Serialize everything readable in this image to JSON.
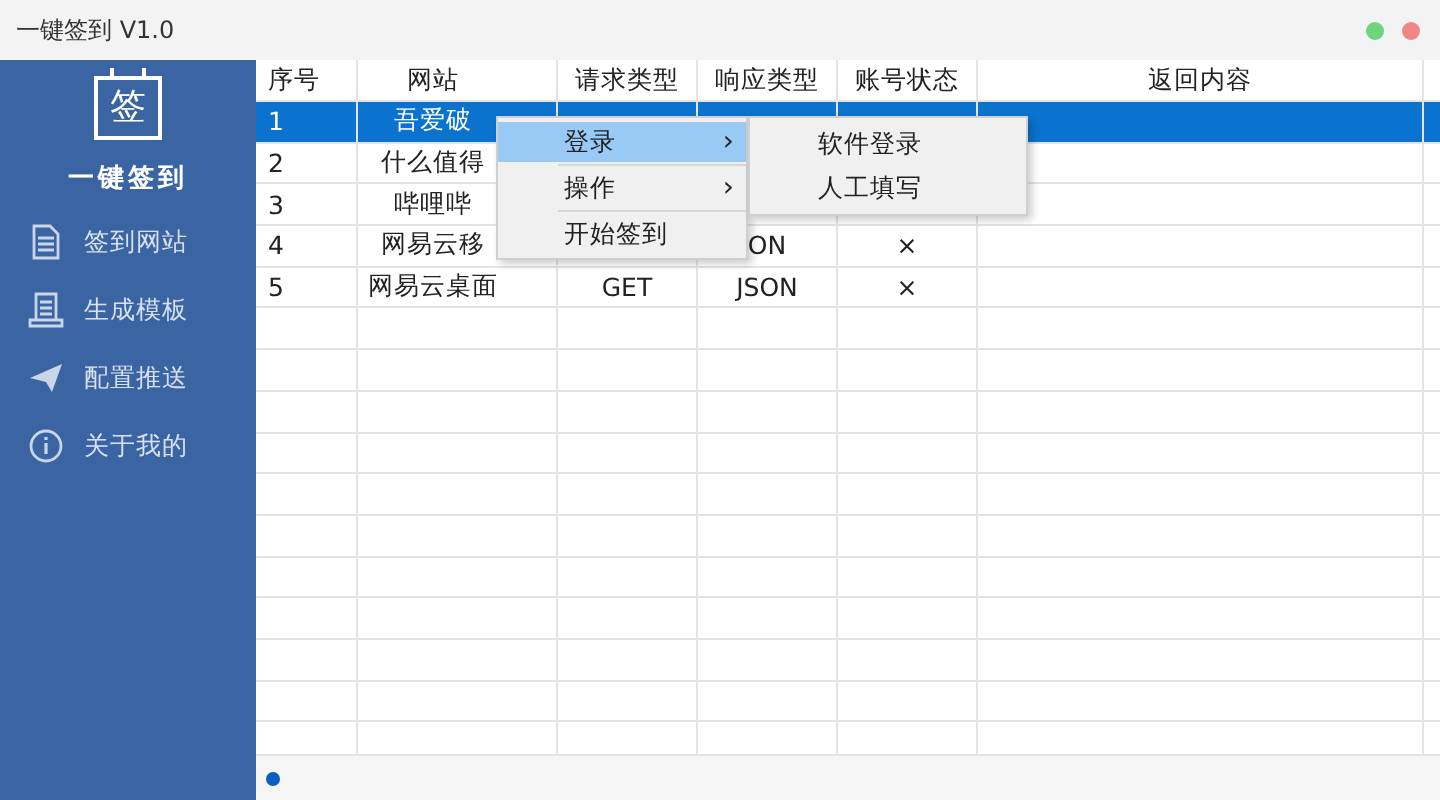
{
  "window": {
    "title": "一键签到 V1.0"
  },
  "sidebar": {
    "logo_char": "签",
    "app_name": "一键签到",
    "items": [
      {
        "label": "签到网站"
      },
      {
        "label": "生成模板"
      },
      {
        "label": "配置推送"
      },
      {
        "label": "关于我的"
      }
    ]
  },
  "table": {
    "columns": [
      "序号",
      "网站",
      "请求类型",
      "响应类型",
      "账号状态",
      "返回内容"
    ],
    "rows": [
      {
        "selected": true,
        "cells": [
          "1",
          "吾爱破",
          "",
          "",
          "",
          ""
        ]
      },
      {
        "selected": false,
        "cells": [
          "2",
          "什么值得",
          "",
          "",
          "",
          ""
        ]
      },
      {
        "selected": false,
        "cells": [
          "3",
          "哔哩哔",
          "",
          "",
          "",
          ""
        ]
      },
      {
        "selected": false,
        "cells": [
          "4",
          "网易云移",
          "",
          "ON",
          "×",
          ""
        ]
      },
      {
        "selected": false,
        "cells": [
          "5",
          "网易云桌面",
          "GET",
          "JSON",
          "×",
          ""
        ]
      }
    ]
  },
  "context_menu": {
    "items": [
      {
        "label": "登录",
        "selected": true,
        "submenu": true
      },
      {
        "label": "操作",
        "selected": false,
        "submenu": true
      },
      {
        "label": "开始签到",
        "selected": false,
        "submenu": false
      }
    ],
    "submenu_chevron": "›",
    "submenu": {
      "items": [
        {
          "label": "软件登录"
        },
        {
          "label": "人工填写"
        }
      ]
    }
  }
}
